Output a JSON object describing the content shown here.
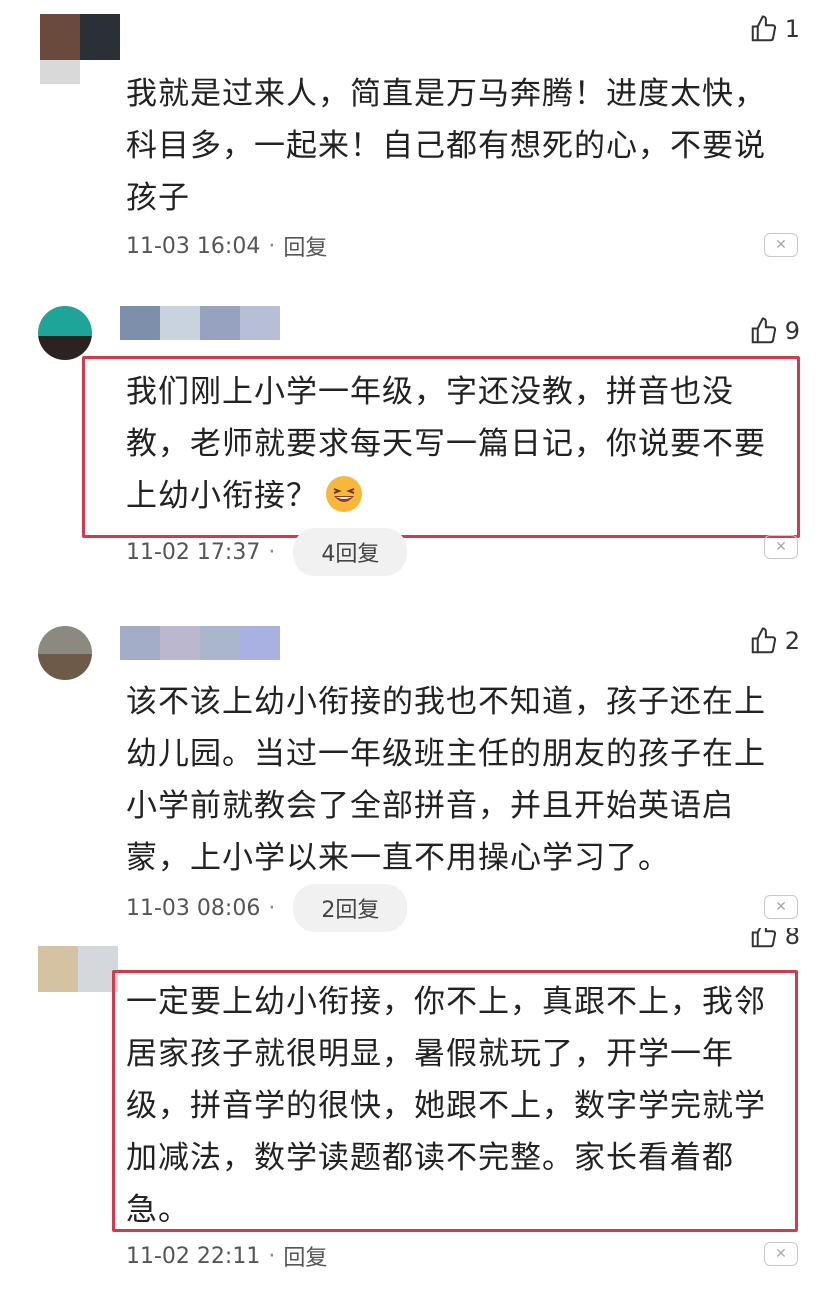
{
  "comments": [
    {
      "likes": "1",
      "text": "我就是过来人，简直是万马奔腾！进度太快，科目多，一起来！自己都有想死的心，不要说孩子",
      "time": "11-03 16:04",
      "reply_label": "回复"
    },
    {
      "likes": "9",
      "text": "我们刚上小学一年级，字还没教，拼音也没教，老师就要求每天写一篇日记，你说要不要上幼小衔接？",
      "time": "11-02 17:37",
      "reply_label": "4回复"
    },
    {
      "likes": "2",
      "text": "该不该上幼小衔接的我也不知道，孩子还在上幼儿园。当过一年级班主任的朋友的孩子在上小学前就教会了全部拼音，并且开始英语启蒙，上小学以来一直不用操心学习了。",
      "time": "11-03 08:06",
      "reply_label": "2回复"
    },
    {
      "likes": "8",
      "text": "一定要上幼小衔接，你不上，真跟不上，我邻居家孩子就很明显，暑假就玩了，开学一年级，拼音学的很快，她跟不上，数字学完就学加减法，数学读题都读不完整。家长看着都急。",
      "time": "11-02 22:11",
      "reply_label": "回复"
    }
  ],
  "colors": {
    "highlight": "#d23a4e",
    "pill_bg": "#f1f1f1"
  },
  "icons": {
    "like": "thumbs-up-icon",
    "close": "close-icon",
    "emoji": "laughing-emoji-icon"
  }
}
